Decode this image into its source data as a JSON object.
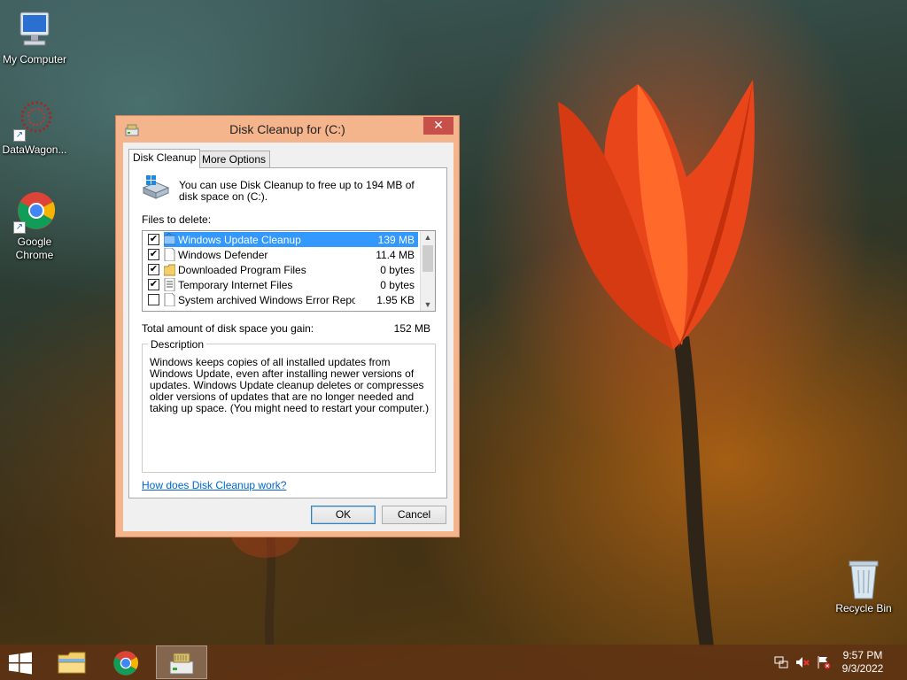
{
  "desktop": {
    "icons": [
      {
        "label": "My Computer"
      },
      {
        "label": "DataWagon..."
      },
      {
        "label": "Google Chrome"
      },
      {
        "label": "Recycle Bin"
      }
    ]
  },
  "dialog": {
    "title": "Disk Cleanup for  (C:)",
    "close_glyph": "✕",
    "tabs": [
      "Disk Cleanup",
      "More Options"
    ],
    "info_text": "You can use Disk Cleanup to free up to 194 MB of disk space on  (C:).",
    "files_label": "Files to delete:",
    "files": [
      {
        "name": "Windows Update Cleanup",
        "size": "139 MB",
        "checked": true,
        "selected": true
      },
      {
        "name": "Windows Defender",
        "size": "11.4 MB",
        "checked": true,
        "selected": false
      },
      {
        "name": "Downloaded Program Files",
        "size": "0 bytes",
        "checked": true,
        "selected": false
      },
      {
        "name": "Temporary Internet Files",
        "size": "0 bytes",
        "checked": true,
        "selected": false
      },
      {
        "name": "System archived Windows Error Repor...",
        "size": "1.95 KB",
        "checked": false,
        "selected": false
      }
    ],
    "check_glyph": "✔",
    "total_label": "Total amount of disk space you gain:",
    "total_value": "152 MB",
    "description_legend": "Description",
    "description_text": "Windows keeps copies of all installed updates from Windows Update, even after installing newer versions of updates. Windows Update cleanup deletes or compresses older versions of updates that are no longer needed and taking up space. (You might need to restart your computer.)",
    "help_link": "How does Disk Cleanup work?",
    "ok_label": "OK",
    "cancel_label": "Cancel"
  },
  "taskbar": {
    "pinned": [
      "file-explorer-icon",
      "chrome-icon",
      "disk-cleanup-icon"
    ],
    "active_index": 2,
    "tray": [
      "network-icon",
      "volume-muted-icon",
      "action-center-flag-icon"
    ],
    "time": "9:57 PM",
    "date": "9/3/2022"
  },
  "colors": {
    "accent_frame": "#f4b48c",
    "close_button": "#c7504a",
    "selection": "#3399ff",
    "link": "#0066cc"
  }
}
